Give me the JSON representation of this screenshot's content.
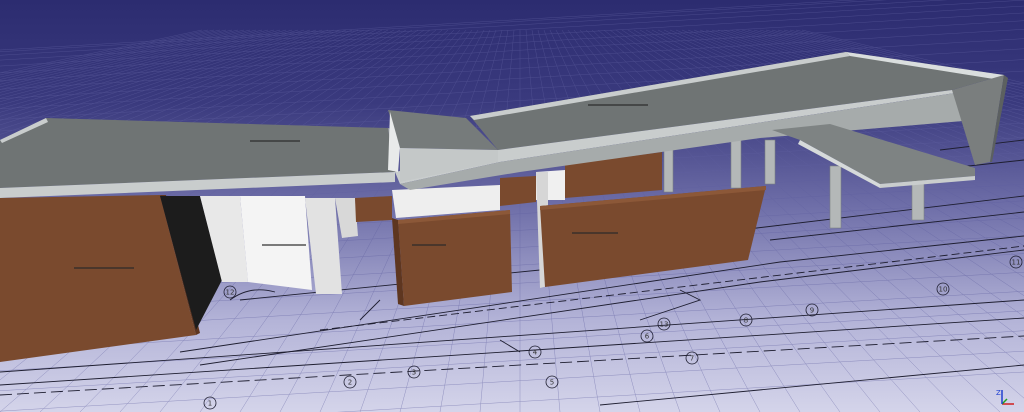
{
  "viewer": {
    "background_top": "#2c2c70",
    "background_bottom": "#d4d4ea",
    "grid_color": "#6060a0"
  },
  "materials": {
    "wall_brown": "#7a4a2e",
    "wall_brown_dark": "#5e3620",
    "wall_white": "#ececec",
    "roof_top": "#6f7474",
    "roof_edge": "#c9cdcd",
    "roof_under": "#a6abab",
    "column": "#b4b8b8"
  },
  "axis_bubbles": [
    "1",
    "2",
    "3",
    "4",
    "5",
    "6",
    "7",
    "8",
    "9",
    "10",
    "11",
    "12",
    "13"
  ],
  "axis_triad": {
    "z": "Z",
    "colors": {
      "x": "#d02020",
      "y": "#20a020",
      "z": "#2040d0"
    }
  }
}
